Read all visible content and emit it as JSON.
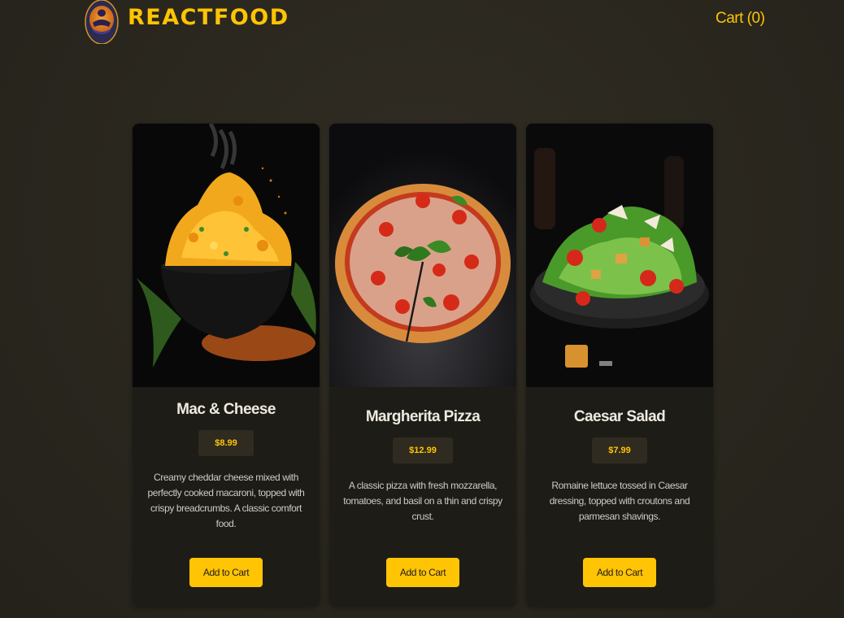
{
  "header": {
    "brand": "REACTFOOD",
    "cart_label": "Cart (0)",
    "logo_icon": "food-logo-icon"
  },
  "meals": [
    {
      "name": "Mac & Cheese",
      "price": "$8.99",
      "description": "Creamy cheddar cheese mixed with perfectly cooked macaroni, topped with crispy breadcrumbs. A classic comfort food.",
      "button_label": "Add to Cart",
      "image_icon": "mac-and-cheese-image"
    },
    {
      "name": "Margherita Pizza",
      "price": "$12.99",
      "description": "A classic pizza with fresh mozzarella, tomatoes, and basil on a thin and crispy crust.",
      "button_label": "Add to Cart",
      "image_icon": "pizza-image"
    },
    {
      "name": "Caesar Salad",
      "price": "$7.99",
      "description": "Romaine lettuce tossed in Caesar dressing, topped with croutons and parmesan shavings.",
      "button_label": "Add to Cart",
      "image_icon": "caesar-salad-image"
    }
  ],
  "colors": {
    "accent": "#ffc404",
    "background": "#29261e",
    "card": "#1e1c17"
  }
}
